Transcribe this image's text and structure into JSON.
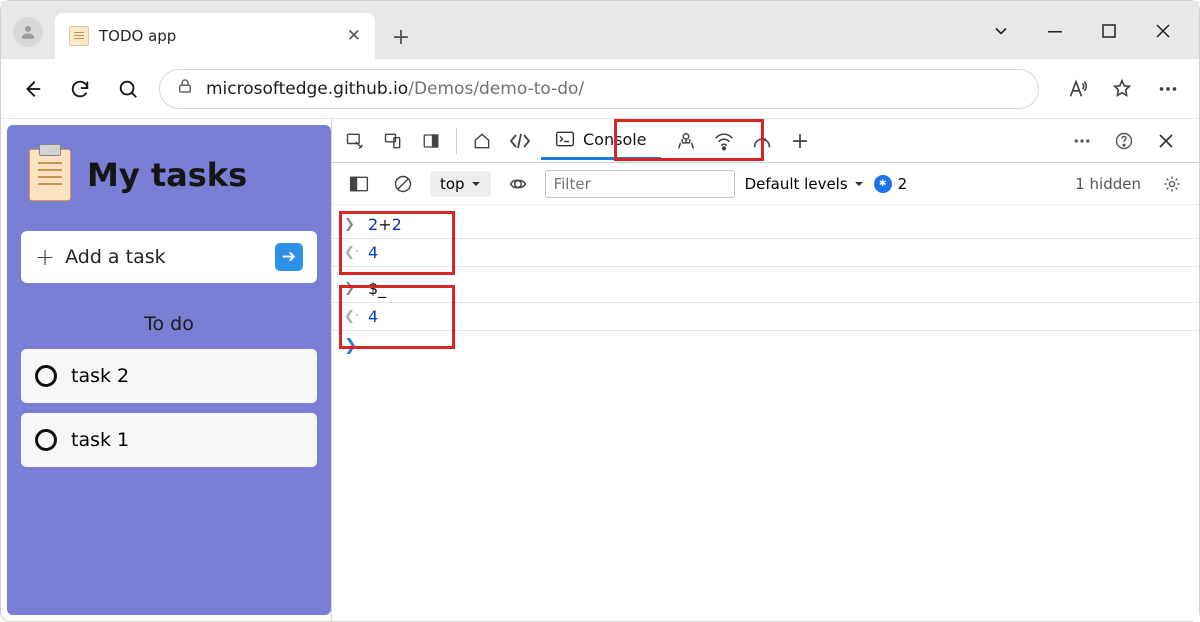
{
  "tab": {
    "title": "TODO app"
  },
  "url": {
    "host": "microsoftedge.github.io",
    "path": "/Demos/demo-to-do/"
  },
  "todo": {
    "title": "My tasks",
    "add_label": "Add a task",
    "section": "To do",
    "tasks": [
      "task 2",
      "task 1"
    ]
  },
  "devtools": {
    "console_tab": "Console",
    "context": "top",
    "filter_placeholder": "Filter",
    "levels": "Default levels",
    "issues": "2",
    "hidden": "1 hidden",
    "log": [
      {
        "type": "in",
        "tokens": [
          {
            "t": "num",
            "v": "2"
          },
          {
            "t": "op",
            "v": "+"
          },
          {
            "t": "num",
            "v": "2"
          }
        ]
      },
      {
        "type": "out",
        "value": "4"
      },
      {
        "type": "in",
        "tokens": [
          {
            "t": "id",
            "v": "$_"
          }
        ]
      },
      {
        "type": "out",
        "value": "4"
      }
    ]
  }
}
